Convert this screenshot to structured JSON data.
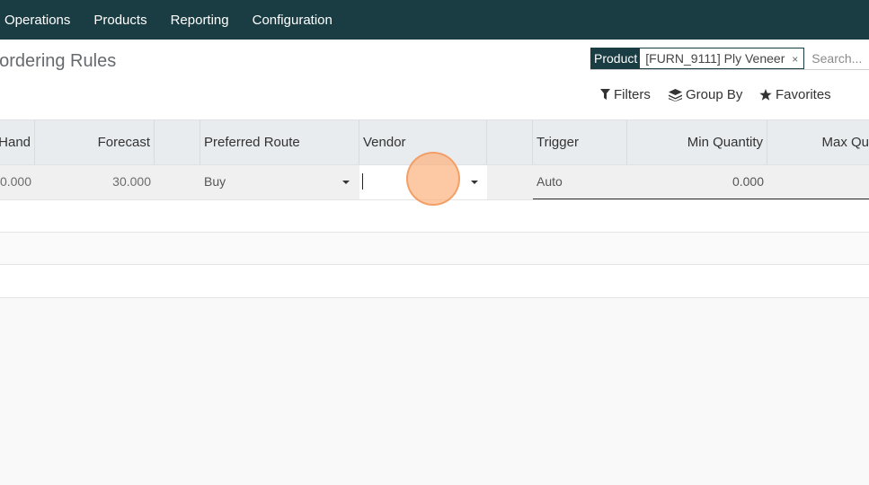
{
  "navbar": {
    "items": [
      "Operations",
      "Products",
      "Reporting",
      "Configuration"
    ]
  },
  "page": {
    "title": "eordering Rules"
  },
  "search": {
    "facet_label": "Product",
    "facet_value": "[FURN_9111] Ply Veneer",
    "facet_remove": "×",
    "placeholder": "Search..."
  },
  "filters": {
    "filters_label": "Filters",
    "group_by_label": "Group By",
    "favorites_label": "Favorites"
  },
  "table": {
    "columns": {
      "on_hand": "Hand",
      "forecast": "Forecast",
      "preferred_route": "Preferred Route",
      "vendor": "Vendor",
      "trigger": "Trigger",
      "min_quantity": "Min Quantity",
      "max_quantity": "Max Qu"
    },
    "rows": [
      {
        "on_hand": "0.000",
        "forecast": "30.000",
        "preferred_route": "Buy",
        "vendor": "",
        "trigger": "Auto",
        "min_quantity": "0.000"
      }
    ]
  },
  "colors": {
    "navbar": "#1a3d44",
    "click_marker": "#fcb27e"
  }
}
